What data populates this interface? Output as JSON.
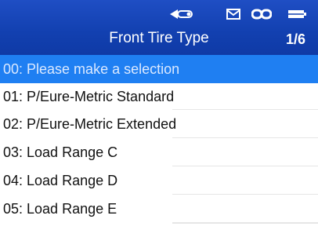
{
  "header": {
    "title": "Front Tire Type",
    "page_indicator": "1/6",
    "background_color": "#1240b0",
    "status_icons": [
      "signal-icon",
      "mail-icon",
      "link-icon",
      "battery-icon"
    ]
  },
  "list": {
    "selected_color": "#1f7ff2",
    "items": [
      {
        "label": "00: Please make a selection",
        "selected": true
      },
      {
        "label": "01: P/Eure-Metric Standard",
        "selected": false
      },
      {
        "label": "02: P/Eure-Metric Extended",
        "selected": false
      },
      {
        "label": "03: Load Range C",
        "selected": false
      },
      {
        "label": "04: Load Range D",
        "selected": false
      },
      {
        "label": "05: Load Range E",
        "selected": false
      }
    ]
  }
}
